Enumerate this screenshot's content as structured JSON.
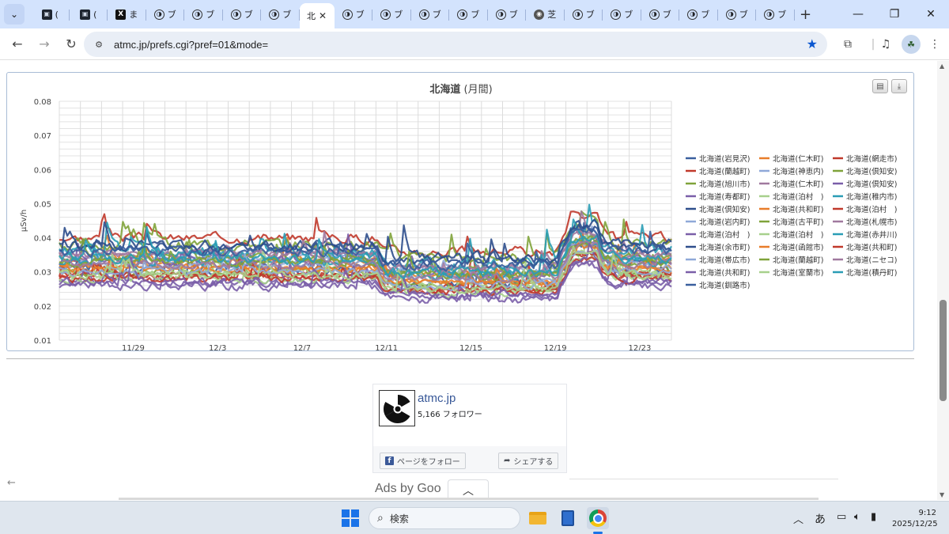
{
  "browser": {
    "tab_search_icon": "chevron-down-icon",
    "tabs": [
      {
        "icon": "app-square-icon",
        "glyph": "▣",
        "label": "(",
        "active": false
      },
      {
        "icon": "app-square-icon",
        "glyph": "▣",
        "label": "(",
        "active": false
      },
      {
        "icon": "x-logo-icon",
        "glyph": "X",
        "label": "ま",
        "active": false
      },
      {
        "icon": "circle-site-icon",
        "glyph": "◑",
        "label": "ブ",
        "active": false
      },
      {
        "icon": "circle-site-icon",
        "glyph": "◑",
        "label": "ブ",
        "active": false
      },
      {
        "icon": "circle-site-icon",
        "glyph": "◑",
        "label": "ブ",
        "active": false
      },
      {
        "icon": "circle-site-icon",
        "glyph": "◑",
        "label": "ブ",
        "active": false
      },
      {
        "icon": "none",
        "glyph": "",
        "label": "北",
        "active": true
      },
      {
        "icon": "circle-site-icon",
        "glyph": "◑",
        "label": "ブ",
        "active": false
      },
      {
        "icon": "circle-site-icon",
        "glyph": "◑",
        "label": "ブ",
        "active": false
      },
      {
        "icon": "circle-site-icon",
        "glyph": "◑",
        "label": "ブ",
        "active": false
      },
      {
        "icon": "circle-site-icon",
        "glyph": "◑",
        "label": "ブ",
        "active": false
      },
      {
        "icon": "circle-site-icon",
        "glyph": "◑",
        "label": "ブ",
        "active": false
      },
      {
        "icon": "globe-icon",
        "glyph": "◉",
        "label": "芝",
        "active": false
      },
      {
        "icon": "circle-site-icon",
        "glyph": "◑",
        "label": "ブ",
        "active": false
      },
      {
        "icon": "circle-site-icon",
        "glyph": "◑",
        "label": "ブ",
        "active": false
      },
      {
        "icon": "circle-site-icon",
        "glyph": "◑",
        "label": "ブ",
        "active": false
      },
      {
        "icon": "circle-site-icon",
        "glyph": "◑",
        "label": "ブ",
        "active": false
      },
      {
        "icon": "circle-site-icon",
        "glyph": "◑",
        "label": "ブ",
        "active": false
      },
      {
        "icon": "circle-site-icon",
        "glyph": "◑",
        "label": "ブ",
        "active": false
      }
    ],
    "url": "atmc.jp/prefs.cgi?pref=01&mode=",
    "accent": "#0b57d0",
    "tabstrip_bg": "#d3e3fd"
  },
  "chart_data": {
    "type": "line",
    "title_main": "北海道",
    "title_sub": " (月間)",
    "ylabel": "μSv/h",
    "ylim": [
      0.01,
      0.08
    ],
    "yticks": [
      "0.01",
      "0.02",
      "0.03",
      "0.04",
      "0.05",
      "0.06",
      "0.07",
      "0.08"
    ],
    "xticks": [
      "11/29",
      "12/3",
      "12/7",
      "12/11",
      "12/15",
      "12/19",
      "12/23"
    ],
    "xrange_days": [
      "11/26",
      "12/25"
    ],
    "grid": true,
    "legend_position": "right",
    "series": [
      {
        "name": "北海道(岩見沢)",
        "color": "#3a5f9e",
        "base": 0.031,
        "amp": 0.013,
        "seed": 1
      },
      {
        "name": "北海道(仁木町)",
        "color": "#e87d2a",
        "base": 0.033,
        "amp": 0.008,
        "seed": 2
      },
      {
        "name": "北海道(網走市)",
        "color": "#c0392b",
        "base": 0.04,
        "amp": 0.01,
        "seed": 3
      },
      {
        "name": "北海道(蘭越町)",
        "color": "#c0392b",
        "base": 0.029,
        "amp": 0.01,
        "seed": 4
      },
      {
        "name": "北海道(神恵内)",
        "color": "#8fa8d8",
        "base": 0.034,
        "amp": 0.008,
        "seed": 5
      },
      {
        "name": "北海道(倶知安)",
        "color": "#7fa33a",
        "base": 0.038,
        "amp": 0.012,
        "seed": 6
      },
      {
        "name": "北海道(旭川市)",
        "color": "#7fa33a",
        "base": 0.03,
        "amp": 0.009,
        "seed": 7
      },
      {
        "name": "北海道(仁木町)",
        "color": "#a0799e",
        "base": 0.035,
        "amp": 0.009,
        "seed": 8
      },
      {
        "name": "北海道(倶知安)",
        "color": "#7a5ea8",
        "base": 0.026,
        "amp": 0.01,
        "seed": 9
      },
      {
        "name": "北海道(寿都町)",
        "color": "#7a5ea8",
        "base": 0.033,
        "amp": 0.01,
        "seed": 10
      },
      {
        "name": "北海道(泊村　)",
        "color": "#a7d08c",
        "base": 0.03,
        "amp": 0.008,
        "seed": 11
      },
      {
        "name": "北海道(稚内市)",
        "color": "#2a9db5",
        "base": 0.036,
        "amp": 0.014,
        "seed": 12
      },
      {
        "name": "北海道(倶知安)",
        "color": "#2e4e8c",
        "base": 0.038,
        "amp": 0.012,
        "seed": 13
      },
      {
        "name": "北海道(共和町)",
        "color": "#e87d2a",
        "base": 0.031,
        "amp": 0.007,
        "seed": 14
      },
      {
        "name": "北海道(泊村　)",
        "color": "#c0392b",
        "base": 0.029,
        "amp": 0.007,
        "seed": 15
      },
      {
        "name": "北海道(岩内町)",
        "color": "#8fa8d8",
        "base": 0.032,
        "amp": 0.008,
        "seed": 16
      },
      {
        "name": "北海道(古平町)",
        "color": "#7fa33a",
        "base": 0.034,
        "amp": 0.009,
        "seed": 17
      },
      {
        "name": "北海道(札幌市)",
        "color": "#a0799e",
        "base": 0.035,
        "amp": 0.009,
        "seed": 18
      },
      {
        "name": "北海道(泊村　)",
        "color": "#7a5ea8",
        "base": 0.027,
        "amp": 0.008,
        "seed": 19
      },
      {
        "name": "北海道(泊村　)",
        "color": "#a7d08c",
        "base": 0.028,
        "amp": 0.008,
        "seed": 20
      },
      {
        "name": "北海道(赤井川)",
        "color": "#2a9db5",
        "base": 0.033,
        "amp": 0.01,
        "seed": 21
      },
      {
        "name": "北海道(余市町)",
        "color": "#2e4e8c",
        "base": 0.037,
        "amp": 0.01,
        "seed": 22
      },
      {
        "name": "北海道(函館市)",
        "color": "#e87d2a",
        "base": 0.031,
        "amp": 0.008,
        "seed": 23
      },
      {
        "name": "北海道(共和町)",
        "color": "#c0392b",
        "base": 0.028,
        "amp": 0.008,
        "seed": 24
      },
      {
        "name": "北海道(帯広市)",
        "color": "#8fa8d8",
        "base": 0.03,
        "amp": 0.007,
        "seed": 25
      },
      {
        "name": "北海道(蘭越町)",
        "color": "#7fa33a",
        "base": 0.033,
        "amp": 0.008,
        "seed": 26
      },
      {
        "name": "北海道(ニセコ)",
        "color": "#a0799e",
        "base": 0.032,
        "amp": 0.008,
        "seed": 27
      },
      {
        "name": "北海道(共和町)",
        "color": "#7a5ea8",
        "base": 0.027,
        "amp": 0.009,
        "seed": 28
      },
      {
        "name": "北海道(室蘭市)",
        "color": "#a7d08c",
        "base": 0.029,
        "amp": 0.008,
        "seed": 29
      },
      {
        "name": "北海道(積丹町)",
        "color": "#2a9db5",
        "base": 0.034,
        "amp": 0.011,
        "seed": 30
      },
      {
        "name": "北海道(釧路市)",
        "color": "#3a5f9e",
        "base": 0.036,
        "amp": 0.01,
        "seed": 31
      }
    ]
  },
  "chart_tools": {
    "print_icon": "printer-icon",
    "download_icon": "download-icon"
  },
  "fb_widget": {
    "page_name": "atmc.jp",
    "followers": "5,166 フォロワー",
    "follow_label": "ページをフォロー",
    "share_label": "シェアする",
    "logo_icon": "radiation-icon"
  },
  "ads": {
    "text": "Ads by Goo",
    "collapse_icon": "chevron-up-icon"
  },
  "taskbar": {
    "search_placeholder": "検索",
    "ime": "あ",
    "time": "9:12",
    "date": "2025/12/25"
  }
}
